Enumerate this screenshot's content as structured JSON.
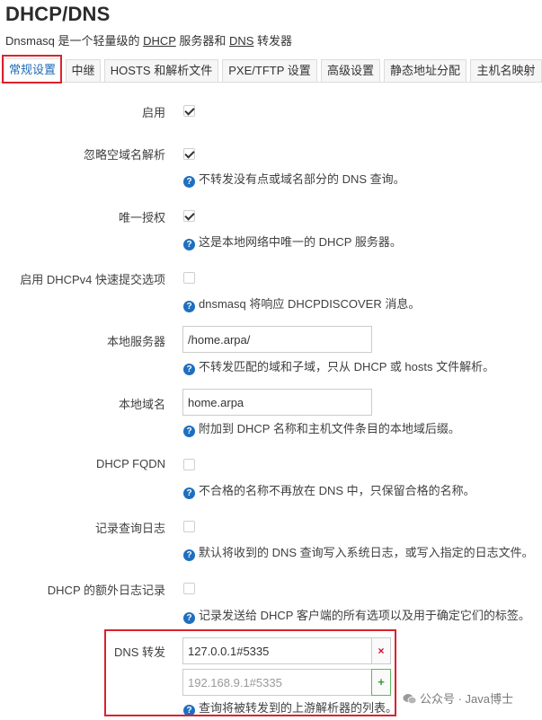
{
  "page": {
    "title": "DHCP/DNS",
    "desc_parts": [
      "Dnsmasq 是一个轻量级的 ",
      "DHCP",
      " 服务器和 ",
      "DNS",
      " 转发器"
    ]
  },
  "tabs": [
    "常规设置",
    "中继",
    "HOSTS 和解析文件",
    "PXE/TFTP 设置",
    "高级设置",
    "静态地址分配",
    "主机名映射"
  ],
  "active_tab": "常规设置",
  "settings": {
    "enable": {
      "label": "启用",
      "checked": true
    },
    "domain_needed": {
      "label": "忽略空域名解析",
      "checked": true,
      "hint": "不转发没有点或域名部分的 DNS 查询。"
    },
    "authoritative": {
      "label": "唯一授权",
      "checked": true,
      "hint": "这是本地网络中唯一的 DHCP 服务器。"
    },
    "rapid_commit": {
      "label": "启用 DHCPv4 快速提交选项",
      "checked": false,
      "hint": "dnsmasq 将响应 DHCPDISCOVER 消息。"
    },
    "local_server": {
      "label": "本地服务器",
      "value": "/home.arpa/",
      "hint": "不转发匹配的域和子域，只从 DHCP 或 hosts 文件解析。"
    },
    "local_domain": {
      "label": "本地域名",
      "value": "home.arpa",
      "hint": "附加到 DHCP 名称和主机文件条目的本地域后缀。"
    },
    "dhcp_fqdn": {
      "label": "DHCP FQDN",
      "checked": false,
      "hint": "不合格的名称不再放在 DNS 中，只保留合格的名称。"
    },
    "log_queries": {
      "label": "记录查询日志",
      "checked": false,
      "hint": "默认将收到的 DNS 查询写入系统日志，或写入指定的日志文件。"
    },
    "log_dhcp": {
      "label": "DHCP 的额外日志记录",
      "checked": false,
      "hint": "记录发送给 DHCP 客户端的所有选项以及用于确定它们的标签。"
    },
    "dns_forward": {
      "label": "DNS 转发",
      "value": "127.0.0.1#5335",
      "placeholder": "192.168.9.1#5335",
      "hint": "查询将被转发到的上游解析器的列表。"
    }
  },
  "buttons": {
    "remove": "×",
    "add": "+"
  },
  "help_glyph": "?",
  "watermark": "公众号 · Java博士",
  "colors": {
    "accent": "#1e6bb8",
    "highlight": "#d9232d",
    "help": "#1f6fbf"
  }
}
